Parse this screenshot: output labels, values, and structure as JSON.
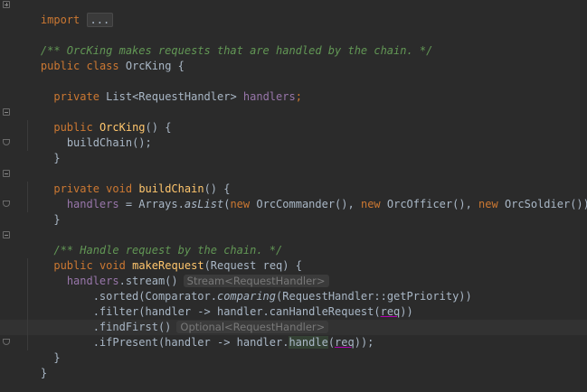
{
  "editor": {
    "language": "Java",
    "collapsed_import": {
      "keyword": "import",
      "placeholder": "..."
    },
    "class_doc": "/** OrcKing makes requests that are handled by the chain. */",
    "class_decl": {
      "mod": "public",
      "kw": "class",
      "name": "OrcKing",
      "brace": " {"
    },
    "field_decl": {
      "mod": "private",
      "type": "List<RequestHandler>",
      "name": "handlers",
      "end": ";"
    },
    "ctor_decl": {
      "mod": "public",
      "name": "OrcKing",
      "rest": "() {"
    },
    "ctor_body": {
      "call": "buildChain",
      "rest": "();"
    },
    "close_brace": "}",
    "build_decl": {
      "mod": "private",
      "kw": "void",
      "name": "buildChain",
      "rest": "() {"
    },
    "build_body": {
      "field": "handlers",
      "p1": " = Arrays.",
      "method": "asList",
      "p2": "(",
      "kw1": "new",
      "c1": " OrcCommander(), ",
      "kw2": "new",
      "c2": " OrcOfficer(), ",
      "kw3": "new",
      "c3": " OrcSoldier());"
    },
    "method_doc": "/** Handle request by the chain. */",
    "make_decl": {
      "mod": "public",
      "kw": "void",
      "name": "makeRequest",
      "rest": "(Request req) {"
    },
    "stream_line": {
      "field": "handlers",
      "rest": ".stream()",
      "hint": "Stream<RequestHandler>"
    },
    "sorted_line": {
      "p1": ".sorted(Comparator.",
      "method": "comparing",
      "p2": "(RequestHandler::getPriority))"
    },
    "filter_line": {
      "p1": ".filter(handler -> handler.canHandleRequest(",
      "param": "req",
      "p2": "))"
    },
    "findfirst_line": {
      "p1": ".findFirst()",
      "hint": "Optional<RequestHandler>"
    },
    "ifpresent_line": {
      "p1": ".ifPresent(handler -> handler.",
      "call": "handle",
      "p2": "(",
      "param": "req",
      "p3": "));"
    }
  }
}
